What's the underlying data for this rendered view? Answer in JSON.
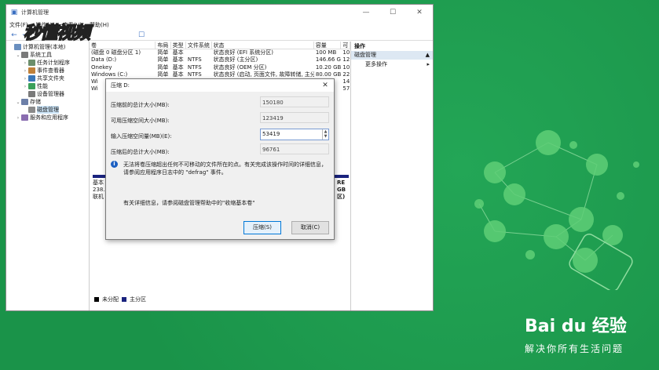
{
  "window": {
    "title": "计算机管理",
    "menu": [
      "文件(F)",
      "操作(A)",
      "查看(V)",
      "帮助(H)"
    ],
    "controls": [
      "—",
      "☐",
      "✕"
    ]
  },
  "watermark": "秒懂视频",
  "tree": [
    {
      "label": "计算机管理(本地)",
      "indent": 0,
      "exp": ""
    },
    {
      "label": "系统工具",
      "indent": 1,
      "exp": "⌄"
    },
    {
      "label": "任务计划程序",
      "indent": 2,
      "exp": "›"
    },
    {
      "label": "事件查看器",
      "indent": 2,
      "exp": "›"
    },
    {
      "label": "共享文件夹",
      "indent": 2,
      "exp": "›"
    },
    {
      "label": "性能",
      "indent": 2,
      "exp": "›"
    },
    {
      "label": "设备管理器",
      "indent": 2,
      "exp": ""
    },
    {
      "label": "存储",
      "indent": 1,
      "exp": "⌄"
    },
    {
      "label": "磁盘管理",
      "indent": 2,
      "exp": "",
      "selected": true
    },
    {
      "label": "服务和应用程序",
      "indent": 1,
      "exp": "›"
    }
  ],
  "volumes": {
    "headers": [
      "卷",
      "布局",
      "类型",
      "文件系统",
      "状态",
      "容量",
      "可"
    ],
    "rows": [
      [
        "(磁盘 0 磁盘分区 1)",
        "简单",
        "基本",
        "",
        "状态良好 (EFI 系统分区)",
        "100 MB",
        "10"
      ],
      [
        "Data (D:)",
        "简单",
        "基本",
        "NTFS",
        "状态良好 (主分区)",
        "146.66 GB",
        "12"
      ],
      [
        "Onekey",
        "简单",
        "基本",
        "NTFS",
        "状态良好 (OEM 分区)",
        "10.20 GB",
        "10"
      ],
      [
        "Windows (C:)",
        "简单",
        "基本",
        "NTFS",
        "状态良好 (启动, 页面文件, 故障转储, 主分区)",
        "80.00 GB",
        "22"
      ],
      [
        "Wi",
        "",
        "",
        "",
        "",
        "",
        "14"
      ],
      [
        "Wi",
        "",
        "",
        "",
        "",
        "",
        "57"
      ]
    ]
  },
  "disk_fragments": [
    "基本",
    "238.",
    "联机"
  ],
  "disk_right_fragments": [
    "RE",
    "GB",
    "区)"
  ],
  "legend": [
    "未分配",
    "主分区"
  ],
  "actions": {
    "title": "操作",
    "section": "磁盘管理",
    "items": [
      "更多操作"
    ]
  },
  "dialog": {
    "title": "压缩 D:",
    "fields": [
      {
        "label": "压缩前的总计大小(MB):",
        "value": "150180"
      },
      {
        "label": "可用压缩空间大小(MB):",
        "value": "123419"
      },
      {
        "label": "输入压缩空间量(MB)(E):",
        "value": "53419"
      },
      {
        "label": "压缩后的总计大小(MB):",
        "value": "96761"
      }
    ],
    "info": "无法将卷压缩超出任何不可移动的文件所在的点。有关完成该操作时间的详细信息，请参阅应用程序日志中的 \"defrag\" 事件。",
    "more": "有关详细信息，请参阅磁盘管理帮助中的\"收缩基本卷\"",
    "ok_label": "压缩(S)",
    "cancel_label": "取消(C)"
  },
  "brand": {
    "logo": "Bai du 经验",
    "slogan": "解决你所有生活问题"
  },
  "colors": {
    "background": "#1d9a4e",
    "accent": "#0078d7",
    "primary_partition": "#1a237e"
  }
}
